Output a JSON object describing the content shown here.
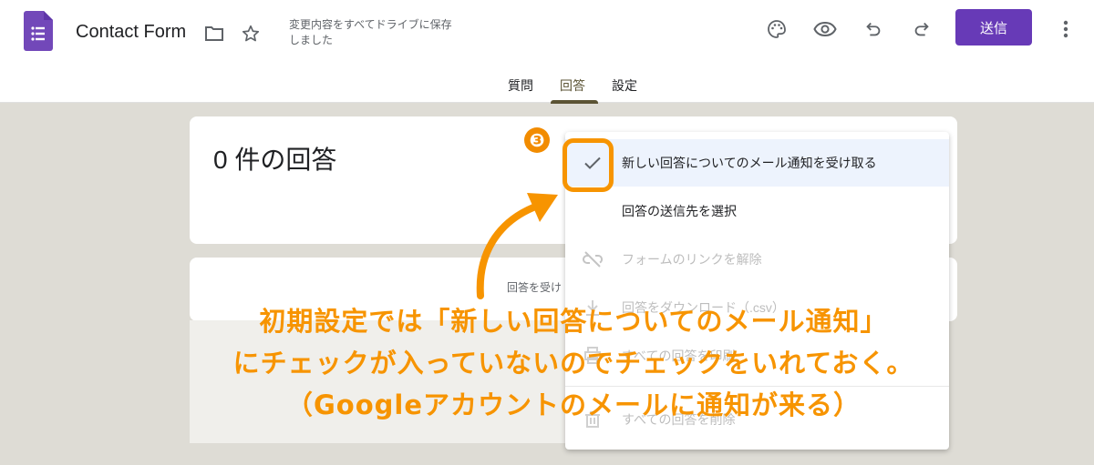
{
  "header": {
    "title": "Contact Form",
    "saved_status": "変更内容をすべてドライブに保存しました",
    "send_label": "送信",
    "brand_color": "#673ab7"
  },
  "icons": [
    "forms-app-icon",
    "folder-icon",
    "star-icon",
    "palette-icon",
    "eye-icon",
    "undo-icon",
    "redo-icon",
    "more-vert-icon"
  ],
  "tabs": [
    {
      "label": "質問",
      "active": false
    },
    {
      "label": "回答",
      "active": true
    },
    {
      "label": "設定",
      "active": false
    }
  ],
  "responses": {
    "count_title": "0 件の回答",
    "accepting_partial": "回答を受け"
  },
  "menu": {
    "items": [
      {
        "label": "新しい回答についてのメール通知を受け取る",
        "checked": true,
        "disabled": false
      },
      {
        "label": "回答の送信先を選択",
        "disabled": false
      },
      {
        "label": "フォームのリンクを解除",
        "disabled": true,
        "icon": "link-off-icon"
      },
      {
        "label": "回答をダウンロード（.csv）",
        "disabled": true,
        "icon": "download-icon"
      },
      {
        "label": "すべての回答を印刷",
        "disabled": true,
        "icon": "print-icon"
      },
      {
        "label": "すべての回答を削除",
        "disabled": true,
        "icon": "delete-icon"
      }
    ]
  },
  "annotation": {
    "step": "❸",
    "lines": [
      "初期設定では「新しい回答についてのメール通知」",
      "にチェックが入っていないのでチェックをいれておく。",
      "（Googleアカウントのメールに通知が来る）"
    ],
    "color": "#f79400"
  }
}
